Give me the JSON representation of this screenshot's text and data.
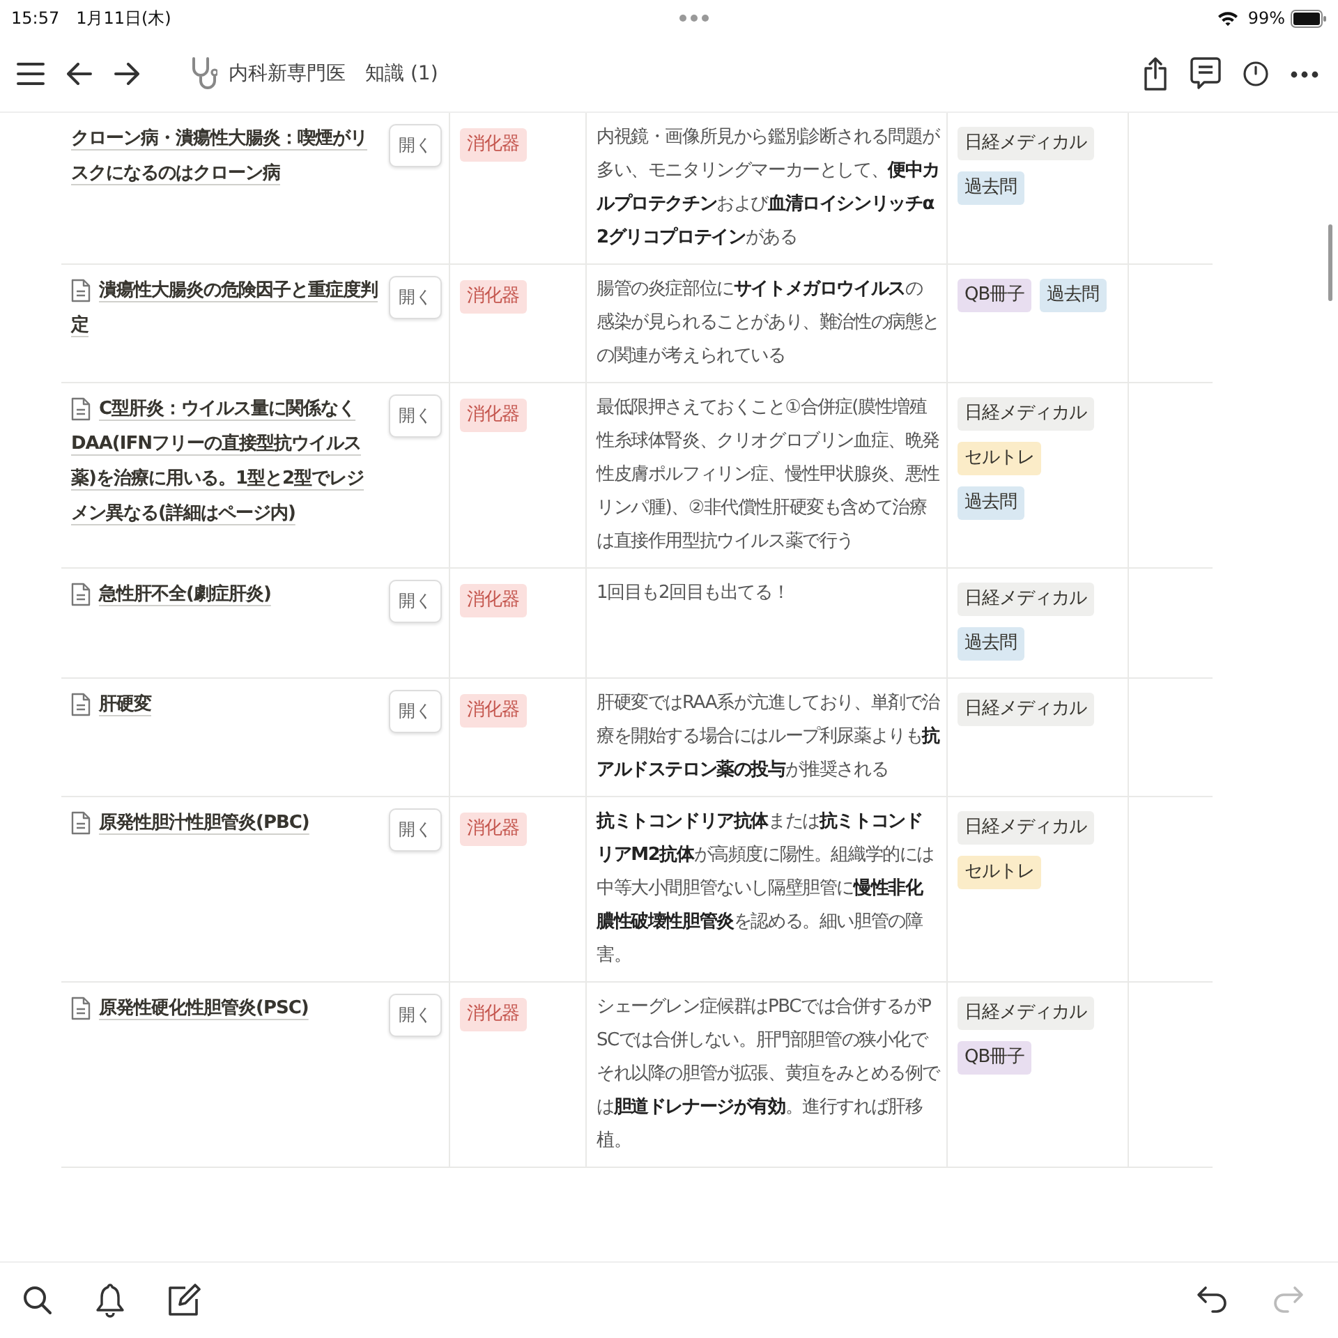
{
  "status_bar": {
    "time": "15:57",
    "date": "1月11日(木)",
    "battery": "99%"
  },
  "toolbar": {
    "breadcrumbs": [
      "内科新専門医",
      "知識 (1)"
    ]
  },
  "table": {
    "rows": [
      {
        "page_icon": false,
        "title": "クローン病・潰瘍性大腸炎：喫煙がリスクになるのはクローン病",
        "open": "開く",
        "category": {
          "label": "消化器",
          "color": "#fbe0de"
        },
        "description": "内視鏡・画像所見から鑑別診断される問題が多い、モニタリングマーカーとして、**便中カルプロテクチン**および**血清ロイシンリッチα2グリコプロテイン**がある",
        "sources": [
          {
            "label": "日経メディカル",
            "color": "#efefed"
          },
          {
            "label": "過去問",
            "color": "#d9e8f2"
          }
        ]
      },
      {
        "page_icon": true,
        "title": "潰瘍性大腸炎の危険因子と重症度判定",
        "open": "開く",
        "category": {
          "label": "消化器",
          "color": "#fbe0de"
        },
        "description": "腸管の炎症部位に**サイトメガロウイルス**の感染が見られることがあり、難治性の病態との関連が考えられている",
        "sources": [
          {
            "label": "QB冊子",
            "color": "#e8def0"
          },
          {
            "label": "過去問",
            "color": "#d9e8f2"
          }
        ]
      },
      {
        "page_icon": true,
        "title": "C型肝炎：ウイルス量に関係なくDAA(IFNフリーの直接型抗ウイルス薬)を治療に用いる。1型と2型でレジメン異なる(詳細はページ内)",
        "open": "開く",
        "category": {
          "label": "消化器",
          "color": "#fbe0de"
        },
        "description": "最低限押さえておくこと①合併症(膜性増殖性糸球体腎炎、クリオグロブリン血症、晩発性皮膚ポルフィリン症、慢性甲状腺炎、悪性リンパ腫)、②非代償性肝硬変も含めて治療は直接作用型抗ウイルス薬で行う",
        "sources": [
          {
            "label": "日経メディカル",
            "color": "#efefed"
          },
          {
            "label": "セルトレ",
            "color": "#fbecc8"
          },
          {
            "label": "過去問",
            "color": "#d9e8f2"
          }
        ]
      },
      {
        "page_icon": true,
        "title": "急性肝不全(劇症肝炎)",
        "open": "開く",
        "category": {
          "label": "消化器",
          "color": "#fbe0de"
        },
        "description": "1回目も2回目も出てる！",
        "sources": [
          {
            "label": "日経メディカル",
            "color": "#efefed"
          },
          {
            "label": "過去問",
            "color": "#d9e8f2"
          }
        ]
      },
      {
        "page_icon": true,
        "title": "肝硬変",
        "open": "開く",
        "category": {
          "label": "消化器",
          "color": "#fbe0de"
        },
        "description": "肝硬変ではRAA系が亢進しており、単剤で治療を開始する場合にはループ利尿薬よりも**抗アルドステロン薬の投与**が推奨される",
        "sources": [
          {
            "label": "日経メディカル",
            "color": "#efefed"
          }
        ]
      },
      {
        "page_icon": true,
        "title": "原発性胆汁性胆管炎(PBC)",
        "open": "開く",
        "category": {
          "label": "消化器",
          "color": "#fbe0de"
        },
        "description": "**抗ミトコンドリア抗体**または**抗ミトコンドリアM2抗体**が高頻度に陽性。組織学的には中等大小間胆管ないし隔壁胆管に**慢性非化膿性破壊性胆管炎**を認める。細い胆管の障害。",
        "sources": [
          {
            "label": "日経メディカル",
            "color": "#efefed"
          },
          {
            "label": "セルトレ",
            "color": "#fbecc8"
          }
        ]
      },
      {
        "page_icon": true,
        "title": "原発性硬化性胆管炎(PSC)",
        "open": "開く",
        "category": {
          "label": "消化器",
          "color": "#fbe0de"
        },
        "description": "シェーグレン症候群はPBCでは合併するがPSCでは合併しない。肝門部胆管の狭小化でそれ以降の胆管が拡張、黄疸をみとめる例では**胆道ドレナージが有効**。進行すれば肝移植。",
        "sources": [
          {
            "label": "日経メディカル",
            "color": "#efefed"
          },
          {
            "label": "QB冊子",
            "color": "#e8def0"
          }
        ]
      }
    ]
  },
  "bottom_bar": {
    "redo_disabled": true
  }
}
